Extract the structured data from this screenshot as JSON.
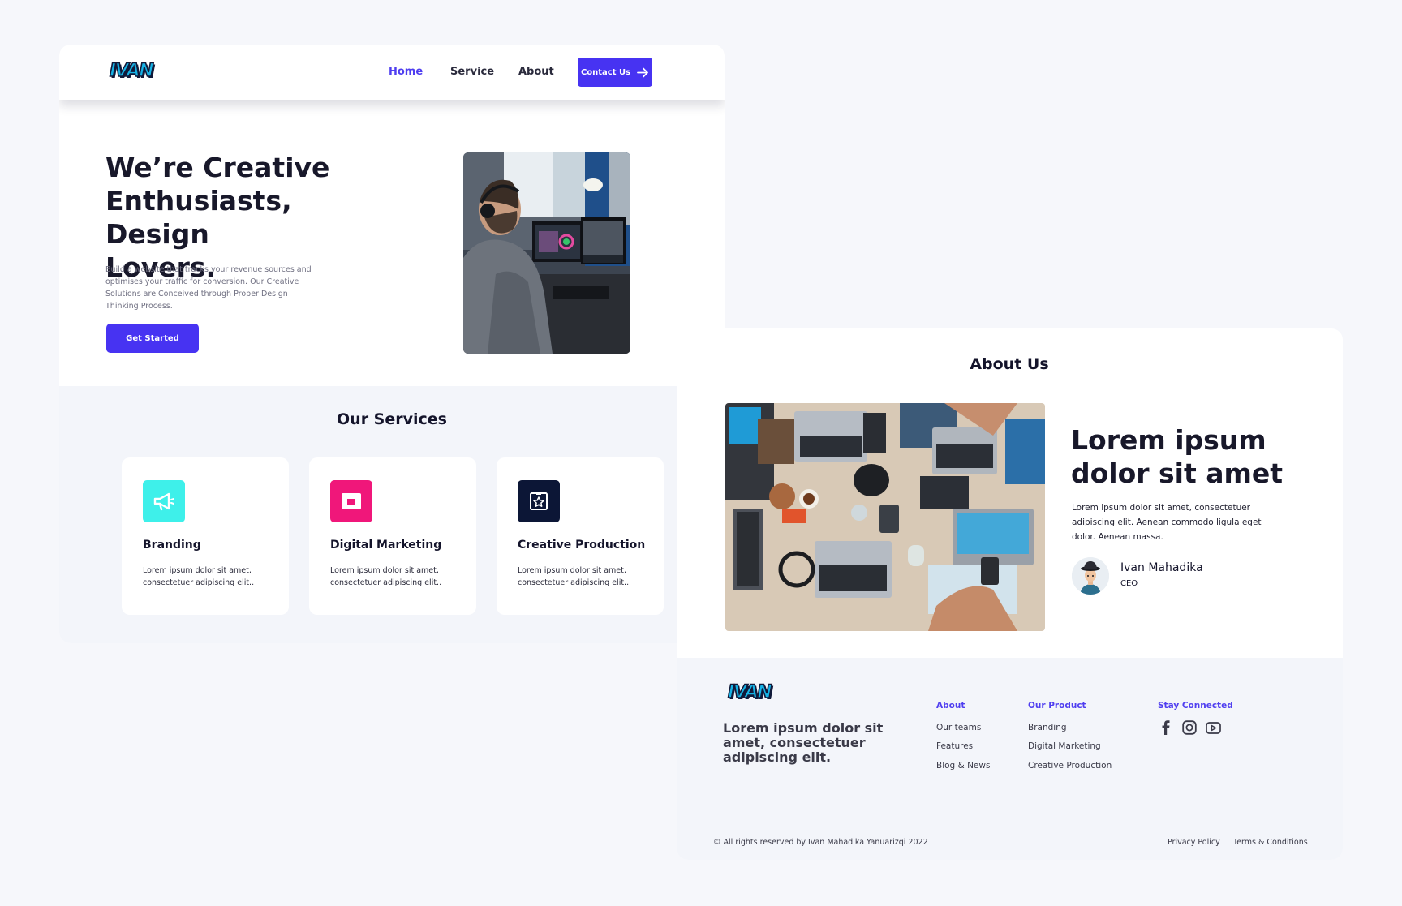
{
  "brand": {
    "logo_text": "IVAN",
    "accent": "#4733f2",
    "logo_color": "#16b3e6"
  },
  "nav": {
    "items": [
      {
        "label": "Home",
        "active": true
      },
      {
        "label": "Service",
        "active": false
      },
      {
        "label": "About",
        "active": false
      }
    ],
    "contact_label": "Contact Us",
    "contact_icon": "arrow-right-icon"
  },
  "hero": {
    "title": "We’re Creative\nEnthusiasts, Design\nLovers.",
    "description": "Build a website that tracks your revenue sources and optimises your traffic for conversion. Our Creative Solutions are Conceived through Proper Design Thinking Process.",
    "cta_label": "Get Started"
  },
  "services": {
    "title": "Our Services",
    "cards": [
      {
        "name": "Branding",
        "description": "Lorem ipsum dolor sit amet, consectetuer adipiscing elit..",
        "icon": "megaphone-icon",
        "color": "#3ef0ea"
      },
      {
        "name": "Digital Marketing",
        "description": "Lorem ipsum dolor sit amet, consectetuer adipiscing elit..",
        "icon": "window-icon",
        "color": "#f0177a"
      },
      {
        "name": "Creative Production",
        "description": "Lorem ipsum dolor sit amet, consectetuer adipiscing elit..",
        "icon": "star-frame-icon",
        "color": "#0c1636"
      }
    ]
  },
  "about": {
    "title": "About Us",
    "heading": "Lorem ipsum dolor sit amet",
    "description": "Lorem ipsum dolor sit amet, consectetuer adipiscing elit. Aenean commodo ligula eget dolor. Aenean massa.",
    "person_name": "Ivan Mahadika",
    "person_role": "CEO"
  },
  "footer": {
    "tagline": "Lorem ipsum dolor sit amet, consectetuer adipiscing elit.",
    "columns": [
      {
        "heading": "About",
        "links": [
          "Our teams",
          "Features",
          "Blog & News"
        ]
      },
      {
        "heading": "Our Product",
        "links": [
          "Branding",
          "Digital Marketing",
          "Creative Production"
        ]
      }
    ],
    "social_heading": "Stay Connected",
    "social_icons": [
      "facebook-icon",
      "instagram-icon",
      "youtube-icon"
    ],
    "copyright": "© All rights reserved by Ivan Mahadika Yanuarizqi 2022",
    "privacy": "Privacy Policy",
    "terms": "Terms & Conditions"
  }
}
